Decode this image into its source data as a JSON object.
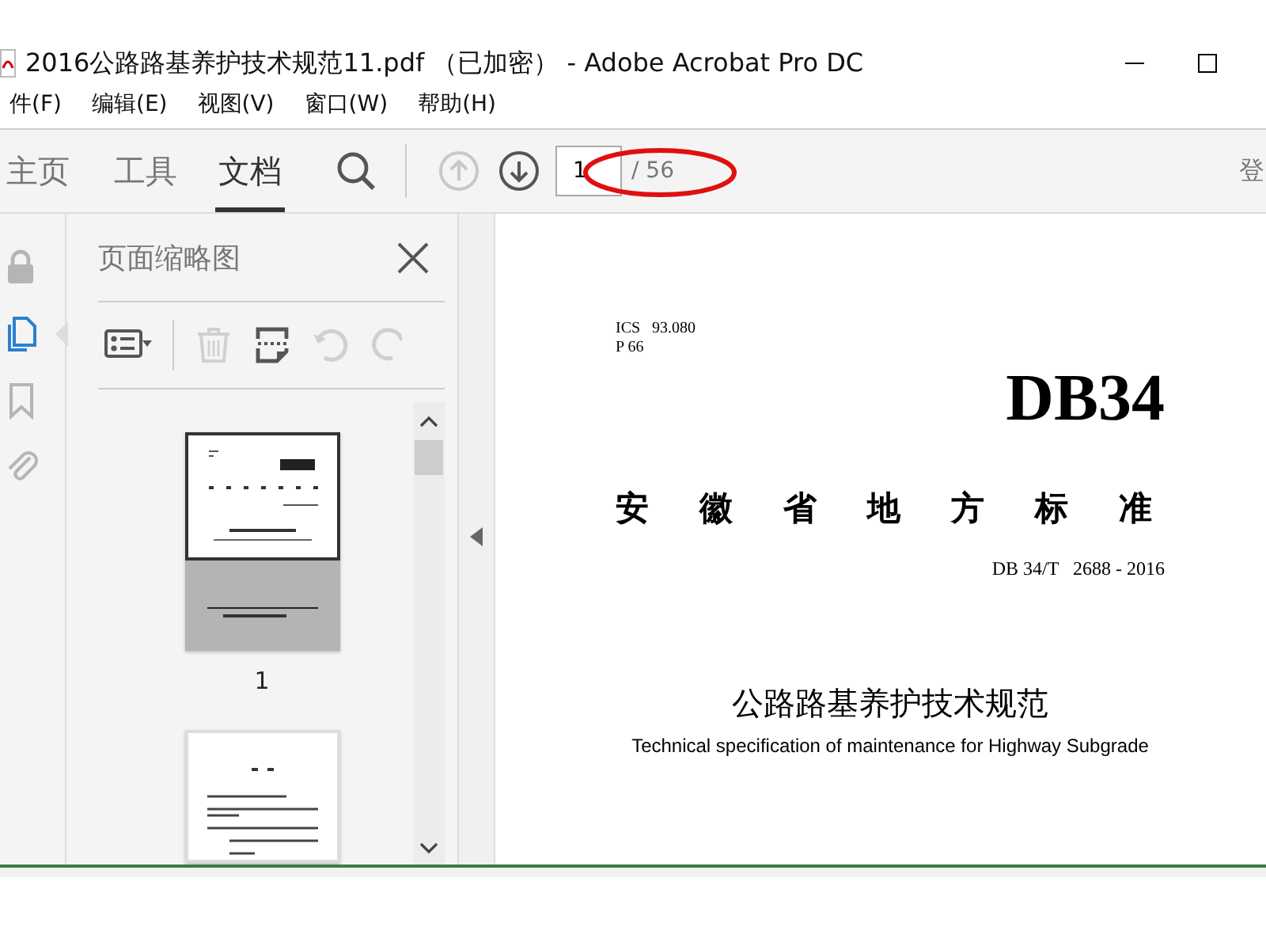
{
  "window": {
    "title": "2016公路路基养护技术规范11.pdf （已加密） - Adobe Acrobat Pro DC"
  },
  "menu": [
    {
      "label": "件(F)"
    },
    {
      "label": "编辑(E)"
    },
    {
      "label": "视图(V)"
    },
    {
      "label": "窗口(W)"
    },
    {
      "label": "帮助(H)"
    }
  ],
  "tabs": [
    {
      "label": "主页",
      "selected": false
    },
    {
      "label": "工具",
      "selected": false
    },
    {
      "label": "文档",
      "selected": true
    }
  ],
  "toolbar": {
    "page": {
      "value": "1"
    },
    "page_count": "/ 56",
    "sign_in": "登",
    "prev_disabled": true
  },
  "sidebar": {
    "items": [
      {
        "kind": "lock",
        "selected": false
      },
      {
        "kind": "pages",
        "selected": true
      },
      {
        "kind": "bookmark",
        "selected": false
      },
      {
        "kind": "attachment",
        "selected": false
      }
    ]
  },
  "thumbnail_panel": {
    "title": "页面缩略图",
    "tools": [
      {
        "kind": "options",
        "disabled": false
      },
      {
        "kind": "delete",
        "disabled": true
      },
      {
        "kind": "insert",
        "disabled": false
      },
      {
        "kind": "undo",
        "disabled": true
      },
      {
        "kind": "redo",
        "disabled": true
      }
    ],
    "pages": [
      {
        "kind": "cover",
        "label": "1",
        "selected": true
      },
      {
        "kind": "text",
        "selected": false
      }
    ]
  },
  "document": {
    "lines": [
      {
        "kind": "meta",
        "text": "ICS   93.080"
      },
      {
        "kind": "meta",
        "text": "P 66"
      },
      {
        "kind": "code",
        "text": "DB34"
      },
      {
        "kind": "spaced",
        "text": "安徽省地方标准"
      },
      {
        "kind": "number",
        "text": "DB 34/T   2688 - 2016"
      },
      {
        "kind": "title",
        "text": "公路路基养护技术规范"
      },
      {
        "kind": "subtitle",
        "text": "Technical specification of maintenance for Highway Subgrade"
      }
    ]
  }
}
